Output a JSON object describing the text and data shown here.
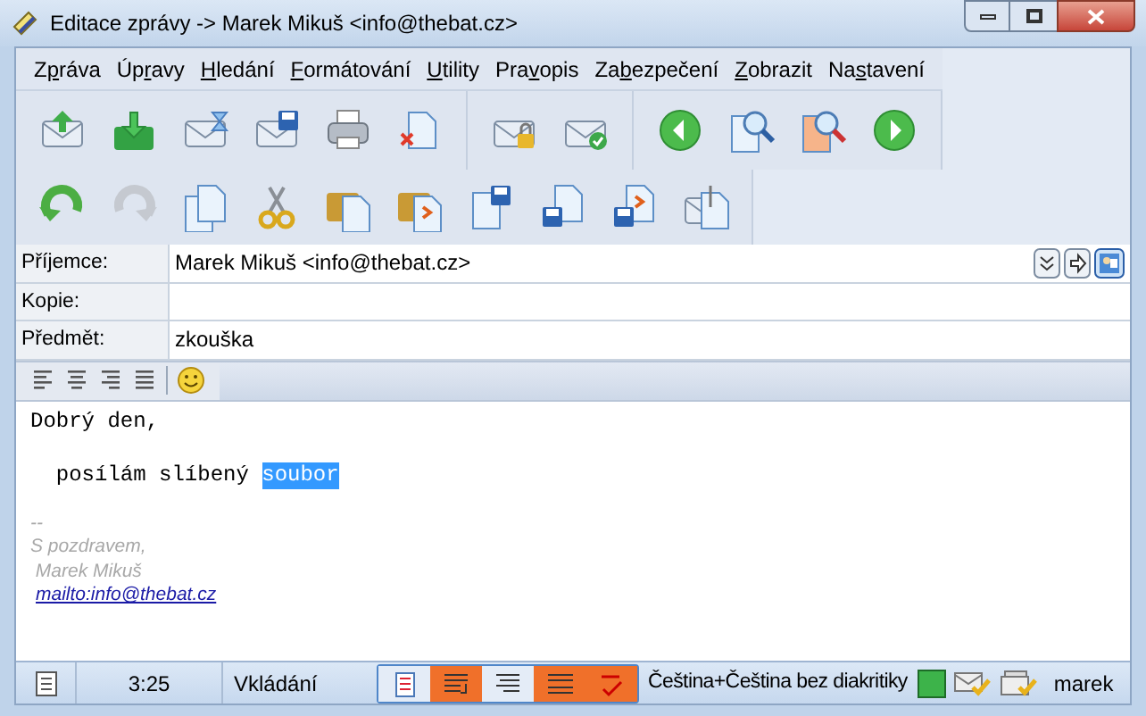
{
  "window": {
    "title": "Editace zprávy -> Marek Mikuš <info@thebat.cz>"
  },
  "menu": [
    {
      "before": "Z",
      "key": "p",
      "after": "ráva"
    },
    {
      "before": "Úp",
      "key": "r",
      "after": "avy"
    },
    {
      "key": "H",
      "after": "ledání"
    },
    {
      "key": "F",
      "after": "ormátování"
    },
    {
      "key": "U",
      "after": "tility"
    },
    {
      "before": "Pra",
      "key": "v",
      "after": "opis"
    },
    {
      "before": "Za",
      "key": "b",
      "after": "ezpečení"
    },
    {
      "key": "Z",
      "after": "obrazit"
    },
    {
      "before": "Na",
      "key": "s",
      "after": "tavení"
    }
  ],
  "toolbar_1": [
    [
      {
        "kind": "send",
        "disabled": false
      },
      {
        "kind": "queue",
        "disabled": false
      },
      {
        "kind": "later",
        "disabled": false
      },
      {
        "kind": "draft",
        "disabled": false
      },
      {
        "kind": "print",
        "disabled": false
      },
      {
        "kind": "discard",
        "disabled": false
      }
    ],
    [
      {
        "kind": "encrypt",
        "disabled": false
      },
      {
        "kind": "sign",
        "disabled": false
      }
    ],
    [
      {
        "kind": "back",
        "disabled": false
      },
      {
        "kind": "find",
        "disabled": false
      },
      {
        "kind": "find-alt",
        "disabled": false
      },
      {
        "kind": "forward",
        "disabled": false
      }
    ]
  ],
  "toolbar_2": [
    {
      "kind": "undo",
      "disabled": false
    },
    {
      "kind": "redo",
      "disabled": true
    },
    {
      "kind": "copy",
      "disabled": false
    },
    {
      "kind": "cut",
      "disabled": false
    },
    {
      "kind": "paste",
      "disabled": false
    },
    {
      "kind": "paste-special",
      "disabled": false
    },
    {
      "kind": "save-doc",
      "disabled": false
    },
    {
      "kind": "disk-doc",
      "disabled": false
    },
    {
      "kind": "disk-doc-arrow",
      "disabled": false
    },
    {
      "kind": "attach",
      "disabled": false
    }
  ],
  "header_fields": [
    {
      "label": "Příjemce:",
      "value": "Marek Mikuš <info@thebat.cz>",
      "buttons": true
    },
    {
      "label": "Kopie:",
      "buttons": false
    },
    {
      "label": "Předmět:",
      "value": "zkouška",
      "buttons": false
    }
  ],
  "format_toolbar": [
    {
      "kind": "align-left"
    },
    {
      "kind": "align-center"
    },
    {
      "kind": "align-right"
    },
    {
      "kind": "justify"
    },
    {
      "kind": "smiley"
    }
  ],
  "body": {
    "lines": [
      [
        {
          "text": "Dobrý den,",
          "selected": false
        }
      ],
      [
        {
          "text": "  posílám slíbený ",
          "selected": false
        },
        {
          "text": "soubor",
          "selected": true
        }
      ]
    ],
    "signature": [
      "--",
      "S pozdravem,",
      " Marek Mikuš"
    ],
    "link": "mailto:info@thebat.cz"
  },
  "status_bar": {
    "time": "3:25",
    "mode": "Vkládání",
    "toggles": [
      {
        "kind": "page",
        "on": false
      },
      {
        "kind": "wrap",
        "on": true
      },
      {
        "kind": "lines",
        "on": false
      },
      {
        "kind": "quote",
        "on": true
      },
      {
        "kind": "spell",
        "on": true
      }
    ],
    "language": "Čeština+Čeština bez diakritiky",
    "user": "marek"
  }
}
